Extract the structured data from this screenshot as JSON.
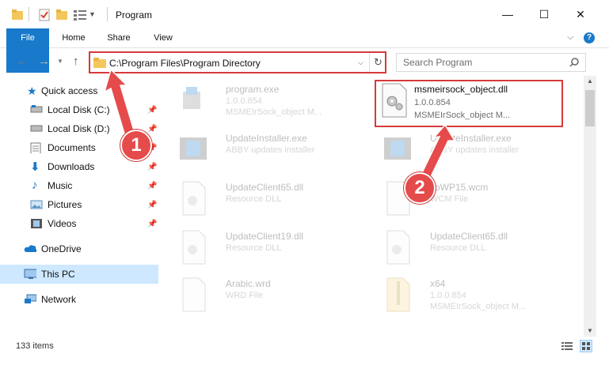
{
  "window": {
    "title": "Program",
    "minimize_icon": "—",
    "maximize_icon": "☐",
    "close_icon": "✕"
  },
  "ribbon": {
    "tabs": [
      "File",
      "Home",
      "Share",
      "View"
    ],
    "expand_icon": "⌵",
    "help_icon": "?"
  },
  "address": {
    "path": "C:\\Program Files\\Program Directory",
    "search_placeholder": "Search Program"
  },
  "sidebar": {
    "items": [
      {
        "label": "Quick access",
        "icon": "star-icon"
      },
      {
        "label": "Local Disk (C:)",
        "icon": "drive-icon",
        "pinned": true
      },
      {
        "label": "Local Disk (D:)",
        "icon": "drive-icon",
        "pinned": true
      },
      {
        "label": "Documents",
        "icon": "documents-icon",
        "pinned": true
      },
      {
        "label": "Downloads",
        "icon": "downloads-icon",
        "pinned": true
      },
      {
        "label": "Music",
        "icon": "music-icon",
        "pinned": true
      },
      {
        "label": "Pictures",
        "icon": "pictures-icon",
        "pinned": true
      },
      {
        "label": "Videos",
        "icon": "videos-icon",
        "pinned": true
      },
      {
        "label": "OneDrive",
        "icon": "cloud-icon"
      },
      {
        "label": "This PC",
        "icon": "computer-icon",
        "selected": true
      },
      {
        "label": "Network",
        "icon": "network-icon"
      }
    ]
  },
  "files": [
    {
      "name": "program.exe",
      "line2": "1.0.0.854",
      "line3": "MSMEIrSock_object M..."
    },
    {
      "name": "msmeirsock_object.dll",
      "line2": "1.0.0.854",
      "line3": "MSMEIrSock_object M..."
    },
    {
      "name": "UpdateInstaller.exe",
      "line2": "ABBY updates installer"
    },
    {
      "name": "UpdateInstaller.exe",
      "line2": "ABBY updates installer"
    },
    {
      "name": "UpdateClient65.dll",
      "line2": "Resource DLL"
    },
    {
      "name": "ToWP15.wcm",
      "line2": "WCM File"
    },
    {
      "name": "UpdateClient19.dll",
      "line2": "Resource DLL"
    },
    {
      "name": "UpdateClient65.dll",
      "line2": "Resource DLL"
    },
    {
      "name": "Arabic.wrd",
      "line2": "WRD File"
    },
    {
      "name": "x64",
      "line2": "1.0.0.854",
      "line3": "MSMEIrSock_object M..."
    }
  ],
  "annotations": {
    "step1": "1",
    "step2": "2"
  },
  "status": {
    "count": "133 items"
  }
}
